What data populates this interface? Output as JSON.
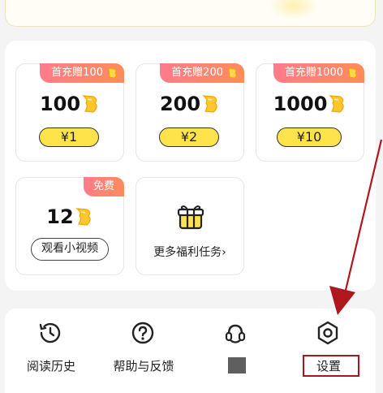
{
  "colors": {
    "accent_yellow": "#ffe34a",
    "badge_pink": "#ff7c8a",
    "badge_orange": "#ff8c5a",
    "annotation_red": "#a8151b"
  },
  "recharge_cards": [
    {
      "badge": "首充赠100",
      "amount": "100",
      "price": "¥1"
    },
    {
      "badge": "首充赠200",
      "amount": "200",
      "price": "¥2"
    },
    {
      "badge": "首充赠1000",
      "amount": "1000",
      "price": "¥10"
    }
  ],
  "video_card": {
    "badge": "免费",
    "amount": "12",
    "button": "观看小视频"
  },
  "more_card": {
    "label": "更多福利任务›",
    "icon": "gift-icon"
  },
  "bottom_menu": [
    {
      "label": "阅读历史",
      "icon": "history-clock-icon"
    },
    {
      "label": "帮助与反馈",
      "icon": "help-question-icon"
    },
    {
      "label": "",
      "icon": "customer-service-icon"
    },
    {
      "label": "设置",
      "icon": "settings-hexagon-icon"
    }
  ]
}
